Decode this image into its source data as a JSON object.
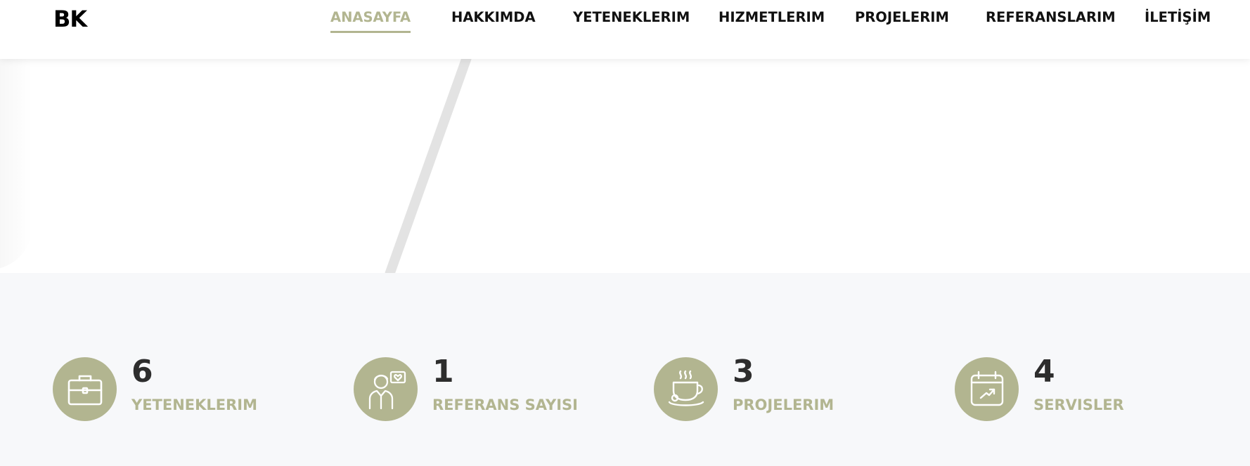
{
  "header": {
    "logo": "BK",
    "nav": [
      {
        "label": "ANASAYFA",
        "active": true
      },
      {
        "label": "HAKKIMDA",
        "active": false
      },
      {
        "label": "YETENEKLERIM",
        "active": false
      },
      {
        "label": "HIZMETLERIM",
        "active": false
      },
      {
        "label": "PROJELERIM",
        "active": false
      },
      {
        "label": "REFERANSLARIM",
        "active": false
      },
      {
        "label": "İLETİŞİM",
        "active": false
      }
    ]
  },
  "stats": [
    {
      "icon": "briefcase-icon",
      "number": "6",
      "label": "YETENEKLERIM"
    },
    {
      "icon": "person-heart-icon",
      "number": "1",
      "label": "REFERANS SAYISI"
    },
    {
      "icon": "coffee-cup-icon",
      "number": "3",
      "label": "PROJELERIM"
    },
    {
      "icon": "calendar-chart-icon",
      "number": "4",
      "label": "SERVISLER"
    }
  ],
  "colors": {
    "accent": "#b2b590",
    "text_dark": "#2d2d2d",
    "stats_bg": "#f7f8fa",
    "diagonal_line": "#e3e3e3"
  }
}
